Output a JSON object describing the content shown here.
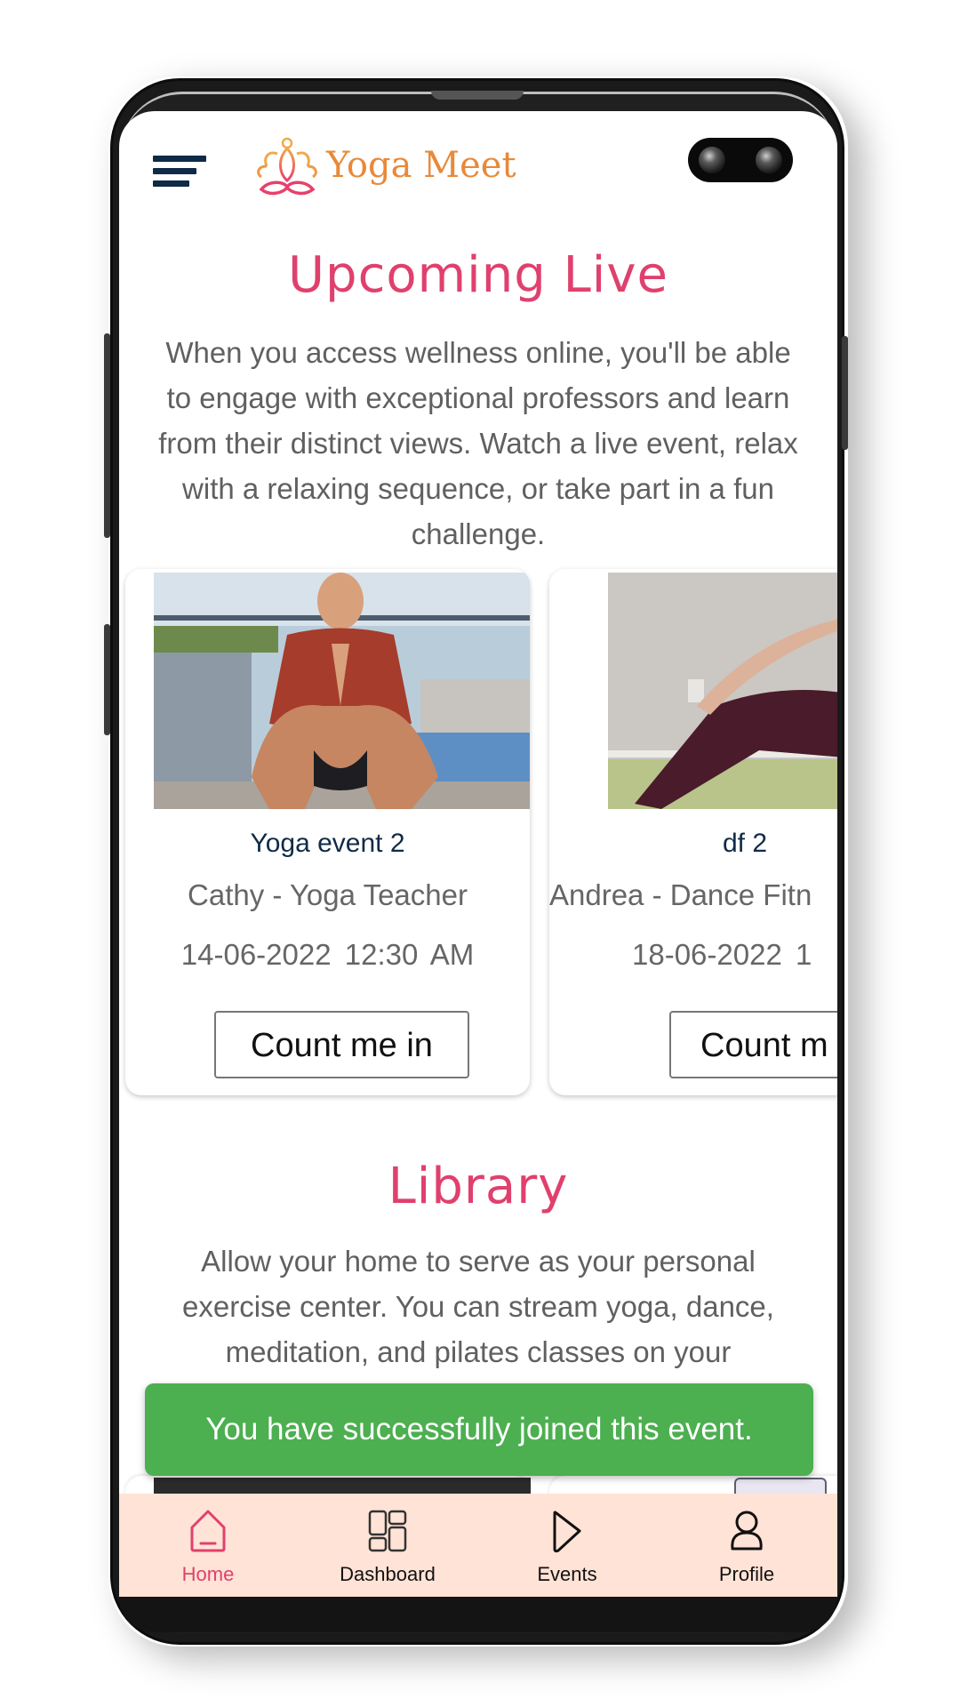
{
  "app": {
    "brand": "Yoga Meet"
  },
  "colors": {
    "accent": "#e0406d",
    "brand_orange": "#e8893a",
    "toast_success": "#4caf50",
    "nav_background": "#ffe3d6",
    "title_navy": "#102b47"
  },
  "header": {
    "menu_icon": "hamburger-icon",
    "logo_icon": "lotus-meditation-icon",
    "logo_text": "Yoga Meet"
  },
  "upcoming": {
    "title": "Upcoming Live",
    "description": "When you access wellness online, you'll be able to engage with exceptional professors and learn from their distinct views. Watch a live event, relax with a relaxing sequence, or take part in a fun challenge.",
    "events": [
      {
        "title": "Yoga event 2",
        "host": "Cathy - Yoga Teacher",
        "date": "14-06-2022",
        "time": "12:30 AM",
        "button": "Count me in",
        "image": "woman in squat yoga pose with prayer hands on rooftop"
      },
      {
        "title": "df 2",
        "host": "Andrea - Dance Fitn",
        "date": "18-06-2022",
        "time": "1",
        "button": "Count m",
        "image": "person in maroon pants sitting against wall"
      }
    ]
  },
  "library": {
    "title": "Library",
    "description_visible": "Allow your home to serve as your personal exercise center. You can stream yoga, dance, meditation, and pilates classes on your"
  },
  "toast": {
    "message": "You have successfully joined this event."
  },
  "bottom_nav": {
    "items": [
      {
        "label": "Home",
        "icon": "home-icon",
        "active": true
      },
      {
        "label": "Dashboard",
        "icon": "dashboard-grid-icon",
        "active": false
      },
      {
        "label": "Events",
        "icon": "play-icon",
        "active": false
      },
      {
        "label": "Profile",
        "icon": "user-icon",
        "active": false
      }
    ]
  }
}
